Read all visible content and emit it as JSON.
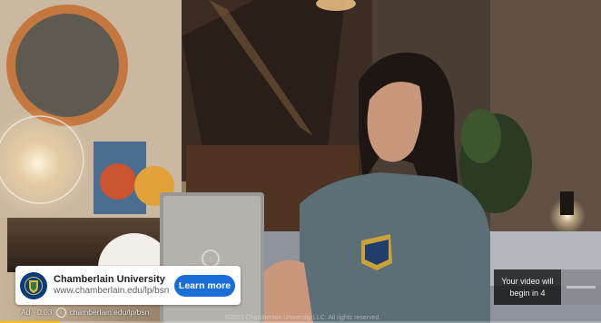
{
  "ad": {
    "advertiser": "Chamberlain University",
    "url": "www.chamberlain.edu/lp/bsn",
    "cta_label": "Learn more",
    "status_prefix": "Ad · 0:03",
    "status_url": "chamberlain.edu/lp/bsn",
    "logo_icon": "university-shield-icon",
    "brand_color": "#0b3d7a",
    "cta_color": "#1a6ed8"
  },
  "skip": {
    "line1": "Your video will",
    "line2": "begin in 4"
  },
  "copyright": "©2023 Chamberlain University LLC. All rights reserved.",
  "progress": {
    "fraction": 0.1,
    "color": "#f2c200"
  }
}
